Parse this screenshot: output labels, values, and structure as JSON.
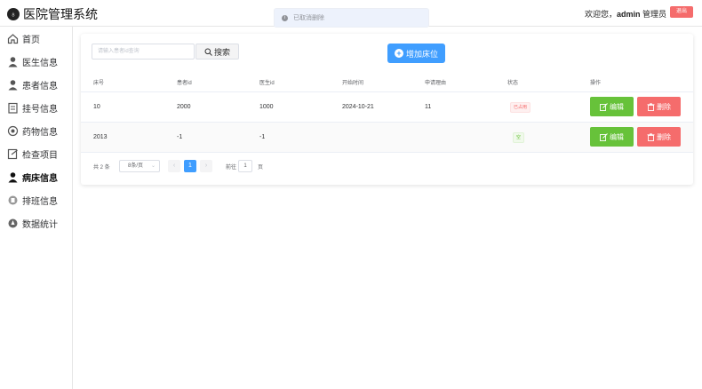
{
  "app": {
    "title": "医院管理系统"
  },
  "header": {
    "welcome": "欢迎您，",
    "username": "admin",
    "role": " 管理员",
    "logout": "退出"
  },
  "toast": {
    "text": "已取消删除"
  },
  "sidebar": {
    "items": [
      {
        "label": "首页",
        "icon": "home-icon"
      },
      {
        "label": "医生信息",
        "icon": "doctor-icon"
      },
      {
        "label": "患者信息",
        "icon": "patient-icon"
      },
      {
        "label": "挂号信息",
        "icon": "registration-icon"
      },
      {
        "label": "药物信息",
        "icon": "medicine-icon"
      },
      {
        "label": "检查项目",
        "icon": "checkup-icon"
      },
      {
        "label": "病床信息",
        "icon": "bed-icon",
        "active": true
      },
      {
        "label": "排班信息",
        "icon": "schedule-icon"
      },
      {
        "label": "数据统计",
        "icon": "statistics-icon"
      }
    ]
  },
  "search": {
    "placeholder": "请输入患者id查询",
    "button": "搜索"
  },
  "add": {
    "label": "增加床位"
  },
  "table": {
    "headers": [
      "床号",
      "患者id",
      "医生id",
      "开始时间",
      "申请理由",
      "状态",
      "操作"
    ],
    "rows": [
      {
        "bed": "10",
        "patient": "2000",
        "doctor": "1000",
        "start": "2024-10-21",
        "reason": "11",
        "status": "已占用",
        "status_color": "#f56c6c"
      },
      {
        "bed": "2013",
        "patient": "-1",
        "doctor": "-1",
        "start": "",
        "reason": "",
        "status": "空",
        "status_color": "#67c23a"
      }
    ],
    "edit_label": "编辑",
    "delete_label": "删除"
  },
  "pagination": {
    "total": "共 2 条",
    "page_size": "8条/页",
    "current_page": "1",
    "goto_label": "前往",
    "goto_value": "1",
    "page_label": "页",
    "prev": "‹",
    "next": "›"
  },
  "colors": {
    "primary": "#409eff",
    "success": "#67c23a",
    "danger": "#f56c6c"
  }
}
